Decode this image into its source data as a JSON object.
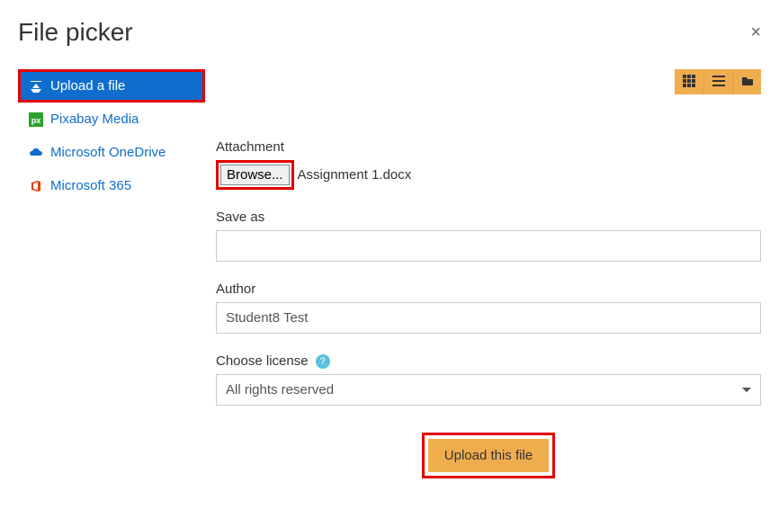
{
  "header": {
    "title": "File picker",
    "close_label": "×"
  },
  "sidebar": {
    "items": [
      {
        "label": "Upload a file",
        "icon": "upload-file-icon"
      },
      {
        "label": "Pixabay Media",
        "icon": "pixabay-icon"
      },
      {
        "label": "Microsoft OneDrive",
        "icon": "onedrive-icon"
      },
      {
        "label": "Microsoft 365",
        "icon": "microsoft365-icon"
      }
    ]
  },
  "toolbar": {
    "view_grid": "grid",
    "view_list": "list",
    "view_tree": "tree"
  },
  "form": {
    "attachment_label": "Attachment",
    "browse_label": "Browse...",
    "selected_file": "Assignment 1.docx",
    "saveas_label": "Save as",
    "saveas_value": "",
    "author_label": "Author",
    "author_value": "Student8 Test",
    "license_label": "Choose license",
    "license_value": "All rights reserved",
    "submit_label": "Upload this file"
  }
}
